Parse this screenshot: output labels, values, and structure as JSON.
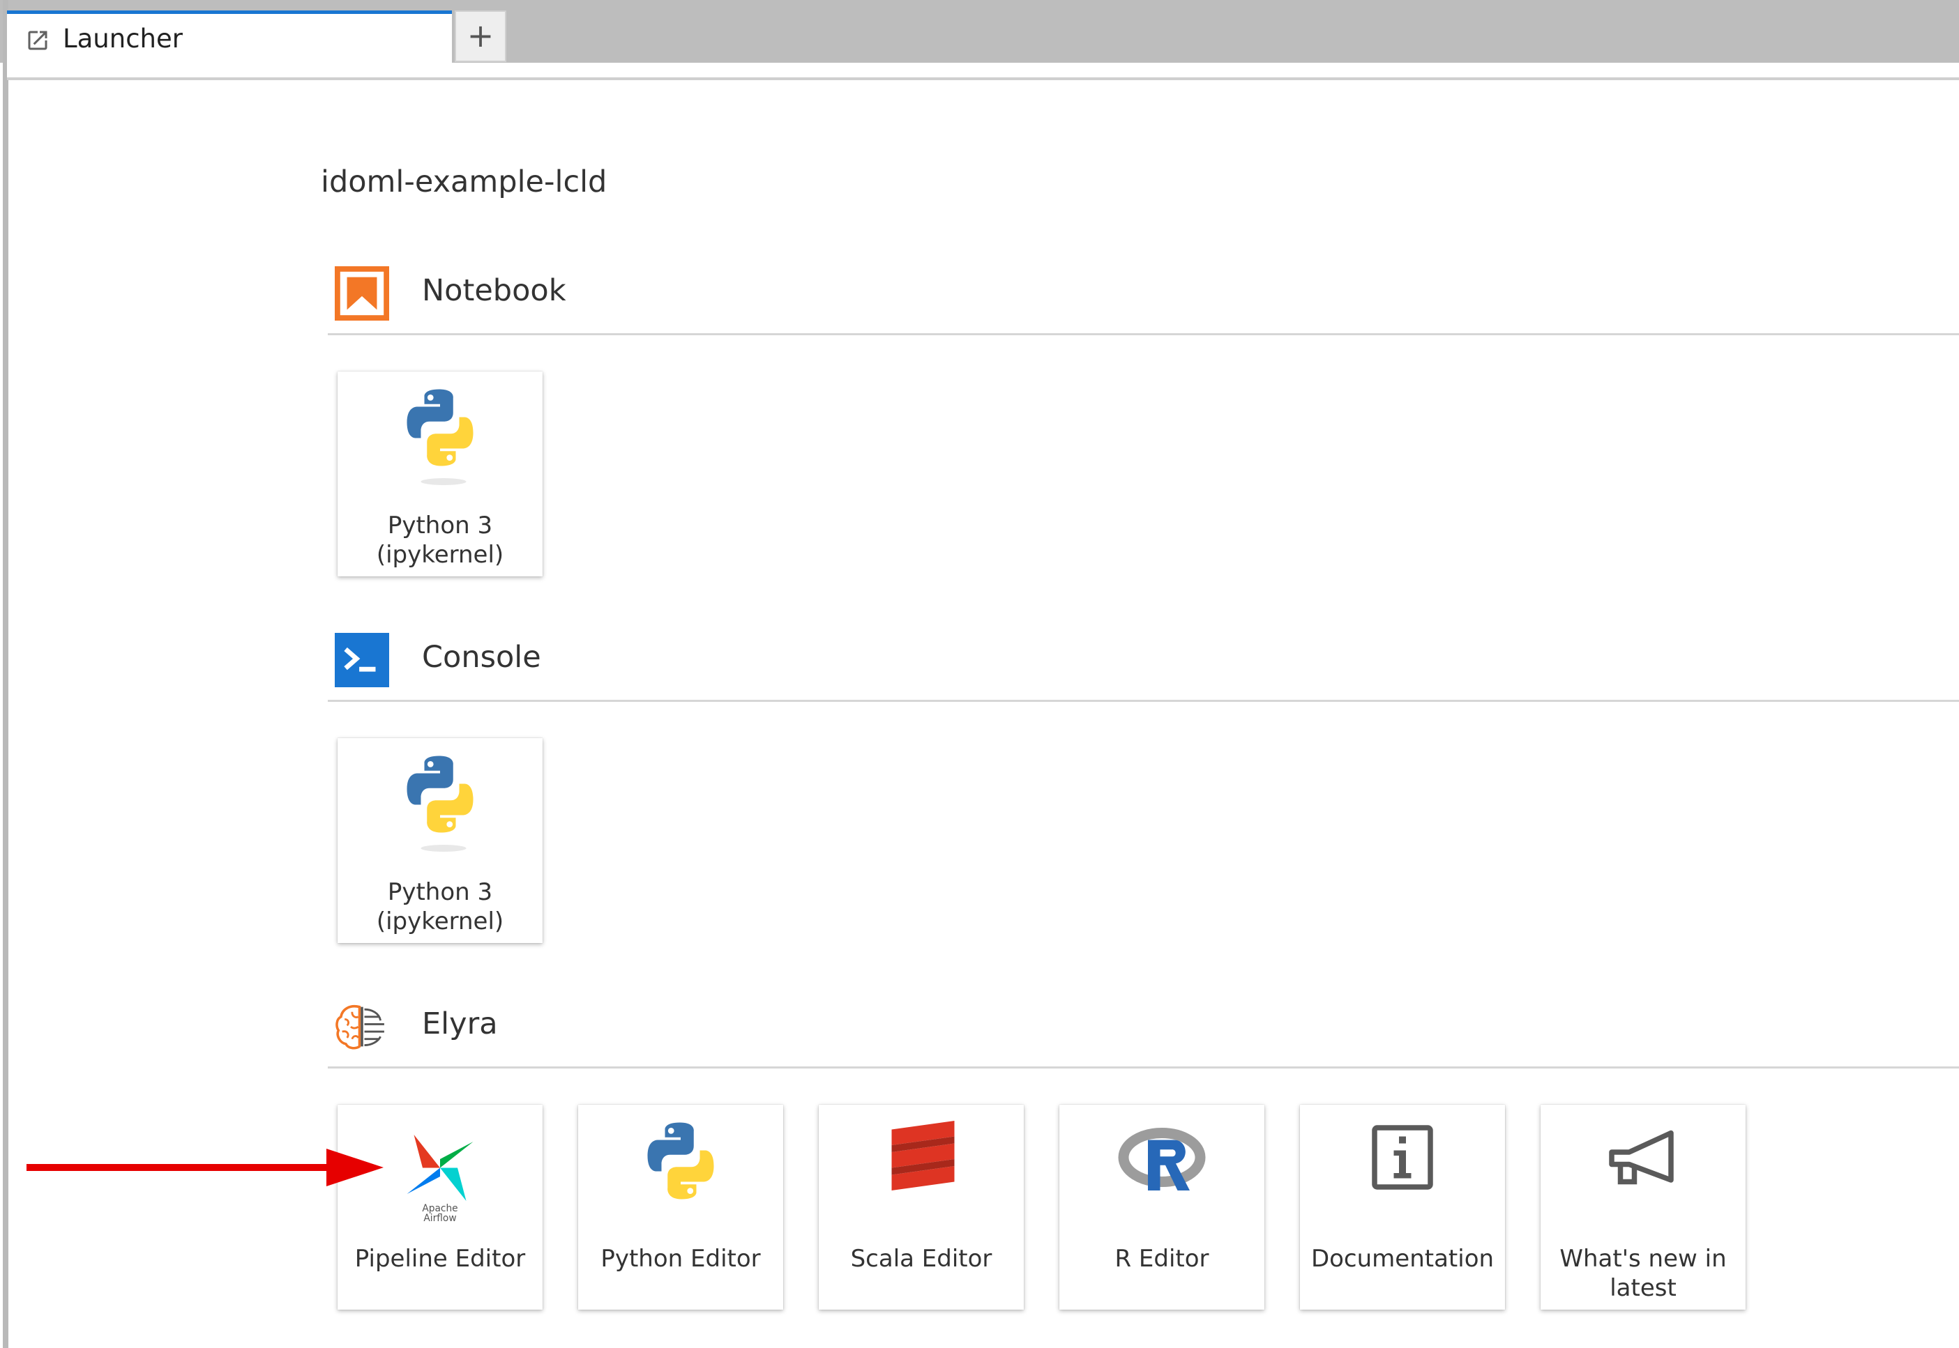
{
  "tabs": [
    {
      "label": "Launcher",
      "icon": "launch-icon",
      "active": true
    }
  ],
  "add_tab_symbol": "+",
  "launcher": {
    "title": "idoml-example-lcld",
    "sections": [
      {
        "name": "Notebook",
        "icon": "notebook-icon",
        "items": [
          {
            "label": "Python 3 (ipykernel)",
            "icon": "python-logo-icon"
          }
        ]
      },
      {
        "name": "Console",
        "icon": "console-icon",
        "items": [
          {
            "label": "Python 3 (ipykernel)",
            "icon": "python-logo-icon"
          }
        ]
      },
      {
        "name": "Elyra",
        "icon": "elyra-brain-icon",
        "items": [
          {
            "label": "Pipeline Editor",
            "icon": "apache-airflow-icon",
            "icon_caption": "Apache Airflow"
          },
          {
            "label": "Python Editor",
            "icon": "python-logo-icon"
          },
          {
            "label": "Scala Editor",
            "icon": "scala-logo-icon"
          },
          {
            "label": "R Editor",
            "icon": "r-logo-icon"
          },
          {
            "label": "Documentation",
            "icon": "info-icon"
          },
          {
            "label": "What's new in latest",
            "icon": "megaphone-icon"
          }
        ]
      }
    ]
  },
  "annotation": {
    "icon": "red-arrow-icon",
    "color": "#e60000"
  },
  "colors": {
    "tab_active_border": "#1976d2",
    "notebook_orange": "#f37726",
    "console_blue": "#1976d2",
    "python_blue": "#3a75b0",
    "python_yellow": "#ffd43b",
    "scala_red": "#de3423",
    "r_blue": "#2768b8",
    "r_gray": "#9c9c9c"
  }
}
